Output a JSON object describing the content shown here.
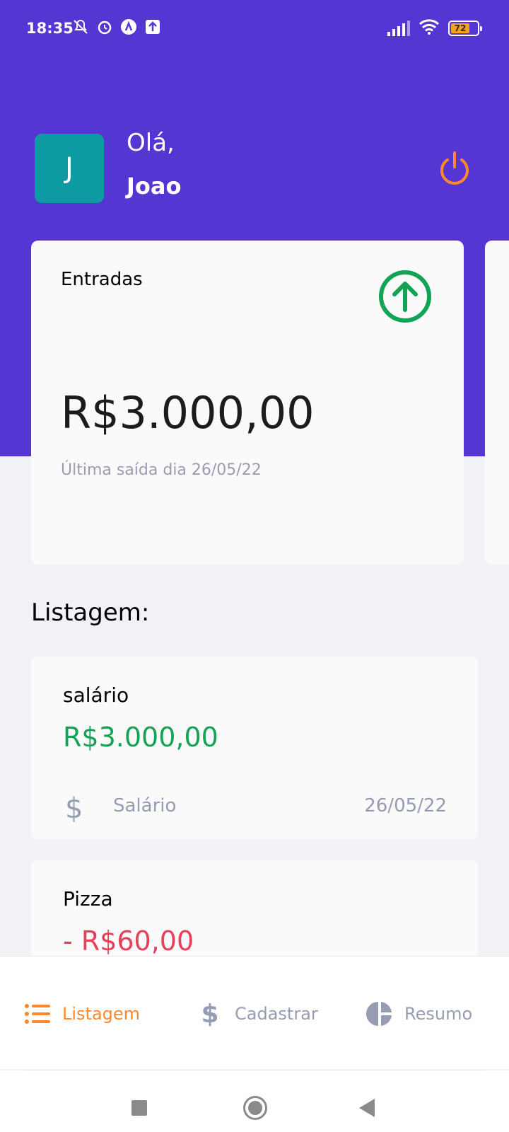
{
  "status_bar": {
    "time": "18:35",
    "battery": "72",
    "icons": [
      "mute-icon",
      "alarm-icon",
      "app-a-icon",
      "upload-icon",
      "signal-icon",
      "wifi-icon",
      "battery-icon"
    ]
  },
  "header": {
    "avatar_letter": "J",
    "greeting": "Olá,",
    "username": "Joao",
    "logout_icon": "power-icon"
  },
  "highlight_card": {
    "title": "Entradas",
    "amount": "R$3.000,00",
    "subtitle": "Última saída dia 26/05/22",
    "icon": "arrow-up-circle-icon",
    "icon_color": "#12a454"
  },
  "listing": {
    "title": "Listagem:",
    "transactions": [
      {
        "name": "salário",
        "amount": "R$3.000,00",
        "type": "positive",
        "category": "Salário",
        "category_icon": "dollar-icon",
        "date": "26/05/22"
      },
      {
        "name": "Pizza",
        "amount": "- R$60,00",
        "type": "negative"
      }
    ]
  },
  "tabbar": {
    "tabs": [
      {
        "label": "Listagem",
        "icon": "list-icon",
        "active": true
      },
      {
        "label": "Cadastrar",
        "icon": "dollar-icon",
        "active": false
      },
      {
        "label": "Resumo",
        "icon": "pie-chart-icon",
        "active": false
      }
    ]
  },
  "colors": {
    "primary": "#5636d3",
    "success": "#12a454",
    "attention": "#e83f5b",
    "secondary": "#ff872c",
    "text": "#969cb2"
  }
}
